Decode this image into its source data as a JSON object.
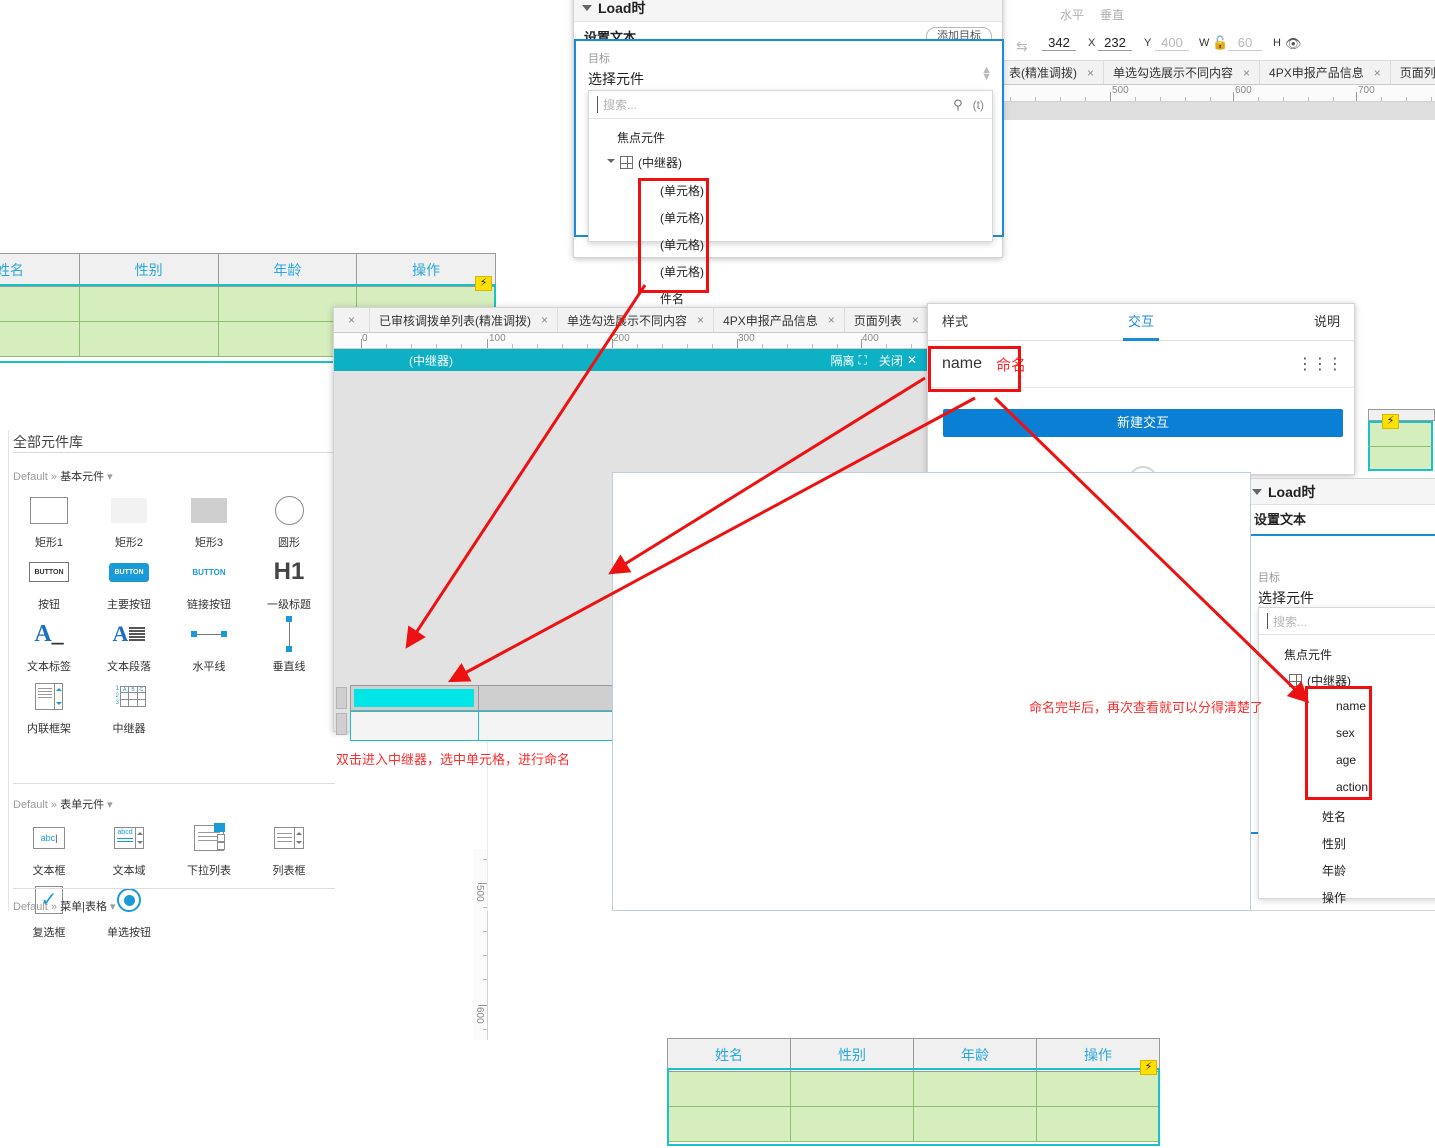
{
  "toolbar": {
    "align_h": "水平",
    "align_v": "垂直",
    "x_value": "342",
    "x_label": "X",
    "y_value": "232",
    "y_label": "Y",
    "w_value": "400",
    "w_label": "W",
    "h_value": "60",
    "h_label": "H",
    "lock_icon": "lock-open-icon",
    "eye_icon": "eye-icon",
    "swap_icon": "swap-icon"
  },
  "top_tabs": {
    "items": [
      {
        "label": "表(精准调拨)",
        "close": "×"
      },
      {
        "label": "单选勾选展示不同内容",
        "close": "×"
      },
      {
        "label": "4PX申报产品信息",
        "close": "×"
      },
      {
        "label": "页面列表",
        "close": ""
      }
    ],
    "ruler_labels": [
      "500",
      "600",
      "700"
    ]
  },
  "mid_tabs": {
    "lead_close": "×",
    "items": [
      {
        "label": "已审核调拨单列表(精准调拨)",
        "close": "×"
      },
      {
        "label": "单选勾选展示不同内容",
        "close": "×"
      },
      {
        "label": "4PX申报产品信息",
        "close": "×"
      },
      {
        "label": "页面列表",
        "close": "×"
      }
    ],
    "overflow_icon": "chevron-down-icon",
    "ruler_labels": [
      "0",
      "100",
      "200",
      "300",
      "400"
    ]
  },
  "load_event_top": {
    "title": "Load时",
    "action": "设置文本",
    "add_target_button": "添加目标",
    "target_label": "目标",
    "target_value": "选择元件",
    "search_placeholder": "搜索...",
    "search_icon": "search-icon",
    "fx_label": "(t)",
    "stepper_icon": "stepper-icon",
    "tree": {
      "group": "焦点元件",
      "root": "(中继器)",
      "root_icon": "repeater-grid-icon",
      "children": [
        "(单元格)",
        "(单元格)",
        "(单元格)",
        "(单元格)"
      ],
      "cut_off": "件名"
    }
  },
  "load_event_bottom": {
    "title": "Load时",
    "action": "设置文本",
    "target_label": "目标",
    "target_value": "选择元件",
    "search_placeholder": "搜索...",
    "tree": {
      "group": "焦点元件",
      "root": "(中继器)",
      "root_icon": "repeater-grid-icon",
      "named": [
        "name",
        "sex",
        "age",
        "action"
      ],
      "after": [
        "姓名",
        "性别",
        "年龄",
        "操作"
      ]
    }
  },
  "repeater_window": {
    "title": "(中继器)",
    "isolate_label": "隔离",
    "isolate_icon": "isolate-icon",
    "close_label": "关闭",
    "close_icon": "close-icon"
  },
  "inspector": {
    "tabs": [
      {
        "label": "样式",
        "active": false
      },
      {
        "label": "交互",
        "active": true
      },
      {
        "label": "说明",
        "active": false
      }
    ],
    "name_value": "name",
    "name_annotation": "命名",
    "new_interaction_button": "新建交互",
    "options_icon": "sliders-icon"
  },
  "annotations": {
    "repeater_hint": "双击进入中继器，选中单元格，进行命名",
    "named_hint": "命名完毕后，再次查看就可以分得清楚了"
  },
  "data_table": {
    "headers": [
      "姓名",
      "性别",
      "年龄",
      "操作"
    ],
    "rows": [
      [
        "",
        "",
        "",
        ""
      ],
      [
        "",
        "",
        "",
        ""
      ]
    ],
    "bolt_icon": "interaction-bolt-icon"
  },
  "library": {
    "title": "全部元件库",
    "groups": [
      {
        "breadcrumb_default": "Default",
        "breadcrumb_sep": "»",
        "breadcrumb_name": "基本元件",
        "caret": "▾",
        "items": [
          {
            "label": "矩形1",
            "icon": "rectangle-outline-icon"
          },
          {
            "label": "矩形2",
            "icon": "rectangle-light-icon"
          },
          {
            "label": "矩形3",
            "icon": "rectangle-gray-icon"
          },
          {
            "label": "圆形",
            "icon": "circle-icon"
          },
          {
            "label": "按钮",
            "icon": "button-outline-icon"
          },
          {
            "label": "主要按钮",
            "icon": "button-primary-icon"
          },
          {
            "label": "链接按钮",
            "icon": "button-link-icon"
          },
          {
            "label": "一级标题",
            "icon": "heading-h1-icon"
          },
          {
            "label": "文本标签",
            "icon": "text-label-icon"
          },
          {
            "label": "文本段落",
            "icon": "text-paragraph-icon"
          },
          {
            "label": "水平线",
            "icon": "horizontal-line-icon"
          },
          {
            "label": "垂直线",
            "icon": "vertical-line-icon"
          },
          {
            "label": "内联框架",
            "icon": "inline-frame-icon"
          },
          {
            "label": "中继器",
            "icon": "repeater-icon"
          }
        ]
      },
      {
        "breadcrumb_default": "Default",
        "breadcrumb_sep": "»",
        "breadcrumb_name": "表单元件",
        "caret": "▾",
        "items": [
          {
            "label": "文本框",
            "icon": "textfield-icon"
          },
          {
            "label": "文本域",
            "icon": "textarea-icon"
          },
          {
            "label": "下拉列表",
            "icon": "dropdown-icon"
          },
          {
            "label": "列表框",
            "icon": "listbox-icon"
          },
          {
            "label": "复选框",
            "icon": "checkbox-icon"
          },
          {
            "label": "单选按钮",
            "icon": "radio-icon"
          }
        ]
      },
      {
        "breadcrumb_default": "Default",
        "breadcrumb_sep": "»",
        "breadcrumb_name": "菜单|表格",
        "caret": "▾",
        "items": []
      }
    ]
  },
  "canvas_rulers": {
    "vertical_labels": [
      "500",
      "600"
    ]
  },
  "colors": {
    "accent_blue": "#1a8bd8",
    "primary_button": "#0b7fd4",
    "repeater_teal": "#0eb0c4",
    "cell_green": "#d6edbe",
    "cell_green_border": "#8fbf72",
    "selection_cyan": "#19c2c8",
    "annotation_red": "#ff2d2d",
    "header_text_blue": "#29a8e0"
  }
}
